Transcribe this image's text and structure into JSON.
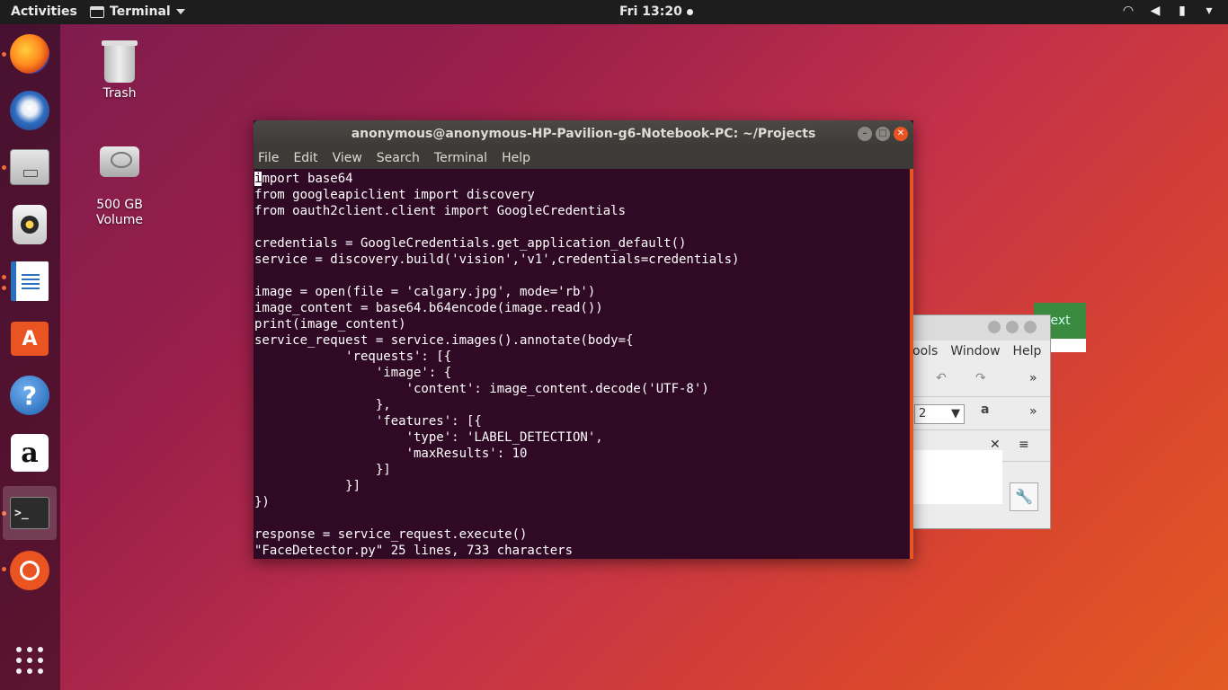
{
  "topbar": {
    "activities": "Activities",
    "app_menu": "Terminal",
    "clock": "Fri 13:20",
    "tray_icons": [
      "wifi-icon",
      "volume-icon",
      "battery-icon",
      "power-menu-caret-icon"
    ]
  },
  "dock": {
    "items": [
      {
        "name": "firefox",
        "running": true
      },
      {
        "name": "thunderbird",
        "running": false
      },
      {
        "name": "files",
        "running": true
      },
      {
        "name": "rhythmbox",
        "running": false
      },
      {
        "name": "libreoffice-writer",
        "running": true
      },
      {
        "name": "ubuntu-software",
        "running": false
      },
      {
        "name": "help",
        "running": false
      },
      {
        "name": "amazon",
        "running": false
      },
      {
        "name": "terminal",
        "running": true
      },
      {
        "name": "ubuntu-one",
        "running": true
      }
    ],
    "store_glyph": "A",
    "help_glyph": "?",
    "amazon_glyph": "a",
    "term_glyph": ">_"
  },
  "desktop": {
    "trash_label": "Trash",
    "volume_label": "500 GB\nVolume"
  },
  "bg_window": {
    "next_button": "Next",
    "menu": [
      "ools",
      "Window",
      "Help"
    ],
    "combo_value": "2"
  },
  "terminal": {
    "title": "anonymous@anonymous-HP-Pavilion-g6-Notebook-PC: ~/Projects",
    "menu": [
      "File",
      "Edit",
      "View",
      "Search",
      "Terminal",
      "Help"
    ],
    "first_char": "i",
    "first_line_rest": "mport base64",
    "lines_after_first": "from googleapiclient import discovery\nfrom oauth2client.client import GoogleCredentials\n\ncredentials = GoogleCredentials.get_application_default()\nservice = discovery.build('vision','v1',credentials=credentials)\n\nimage = open(file = 'calgary.jpg', mode='rb')\nimage_content = base64.b64encode(image.read())\nprint(image_content)\nservice_request = service.images().annotate(body={\n            'requests': [{\n                'image': {\n                    'content': image_content.decode('UTF-8')\n                },\n                'features': [{\n                    'type': 'LABEL_DETECTION',\n                    'maxResults': 10\n                }]\n            }]\n})\n\nresponse = service_request.execute()",
    "status_line": "\"FaceDetector.py\" 25 lines, 733 characters"
  },
  "colors": {
    "accent": "#e95420",
    "terminal_bg": "#300a24",
    "topbar_bg": "#1d1d1d"
  }
}
